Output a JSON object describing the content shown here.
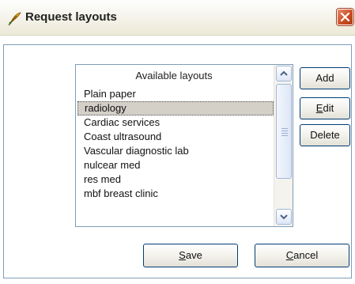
{
  "window": {
    "title": "Request layouts"
  },
  "list": {
    "header": "Available layouts",
    "items": [
      "Plain paper",
      "radiology",
      "Cardiac services",
      "Coast ultrasound",
      "Vascular diagnostic lab",
      "nulcear med",
      "res med",
      "mbf breast clinic"
    ],
    "selected_index": 1
  },
  "buttons": {
    "add": "Add",
    "edit_access": "E",
    "edit_rest": "dit",
    "delete": "Delete",
    "save_access": "S",
    "save_rest": "ave",
    "cancel_access": "C",
    "cancel_rest": "ancel"
  },
  "icons": {
    "app": "feather-icon",
    "close": "close-icon",
    "scroll_up": "chevron-up-icon",
    "scroll_down": "chevron-down-icon"
  },
  "colors": {
    "close_button": "#c84b21",
    "selection": "#d4d0c8",
    "border": "#7f9db9"
  }
}
